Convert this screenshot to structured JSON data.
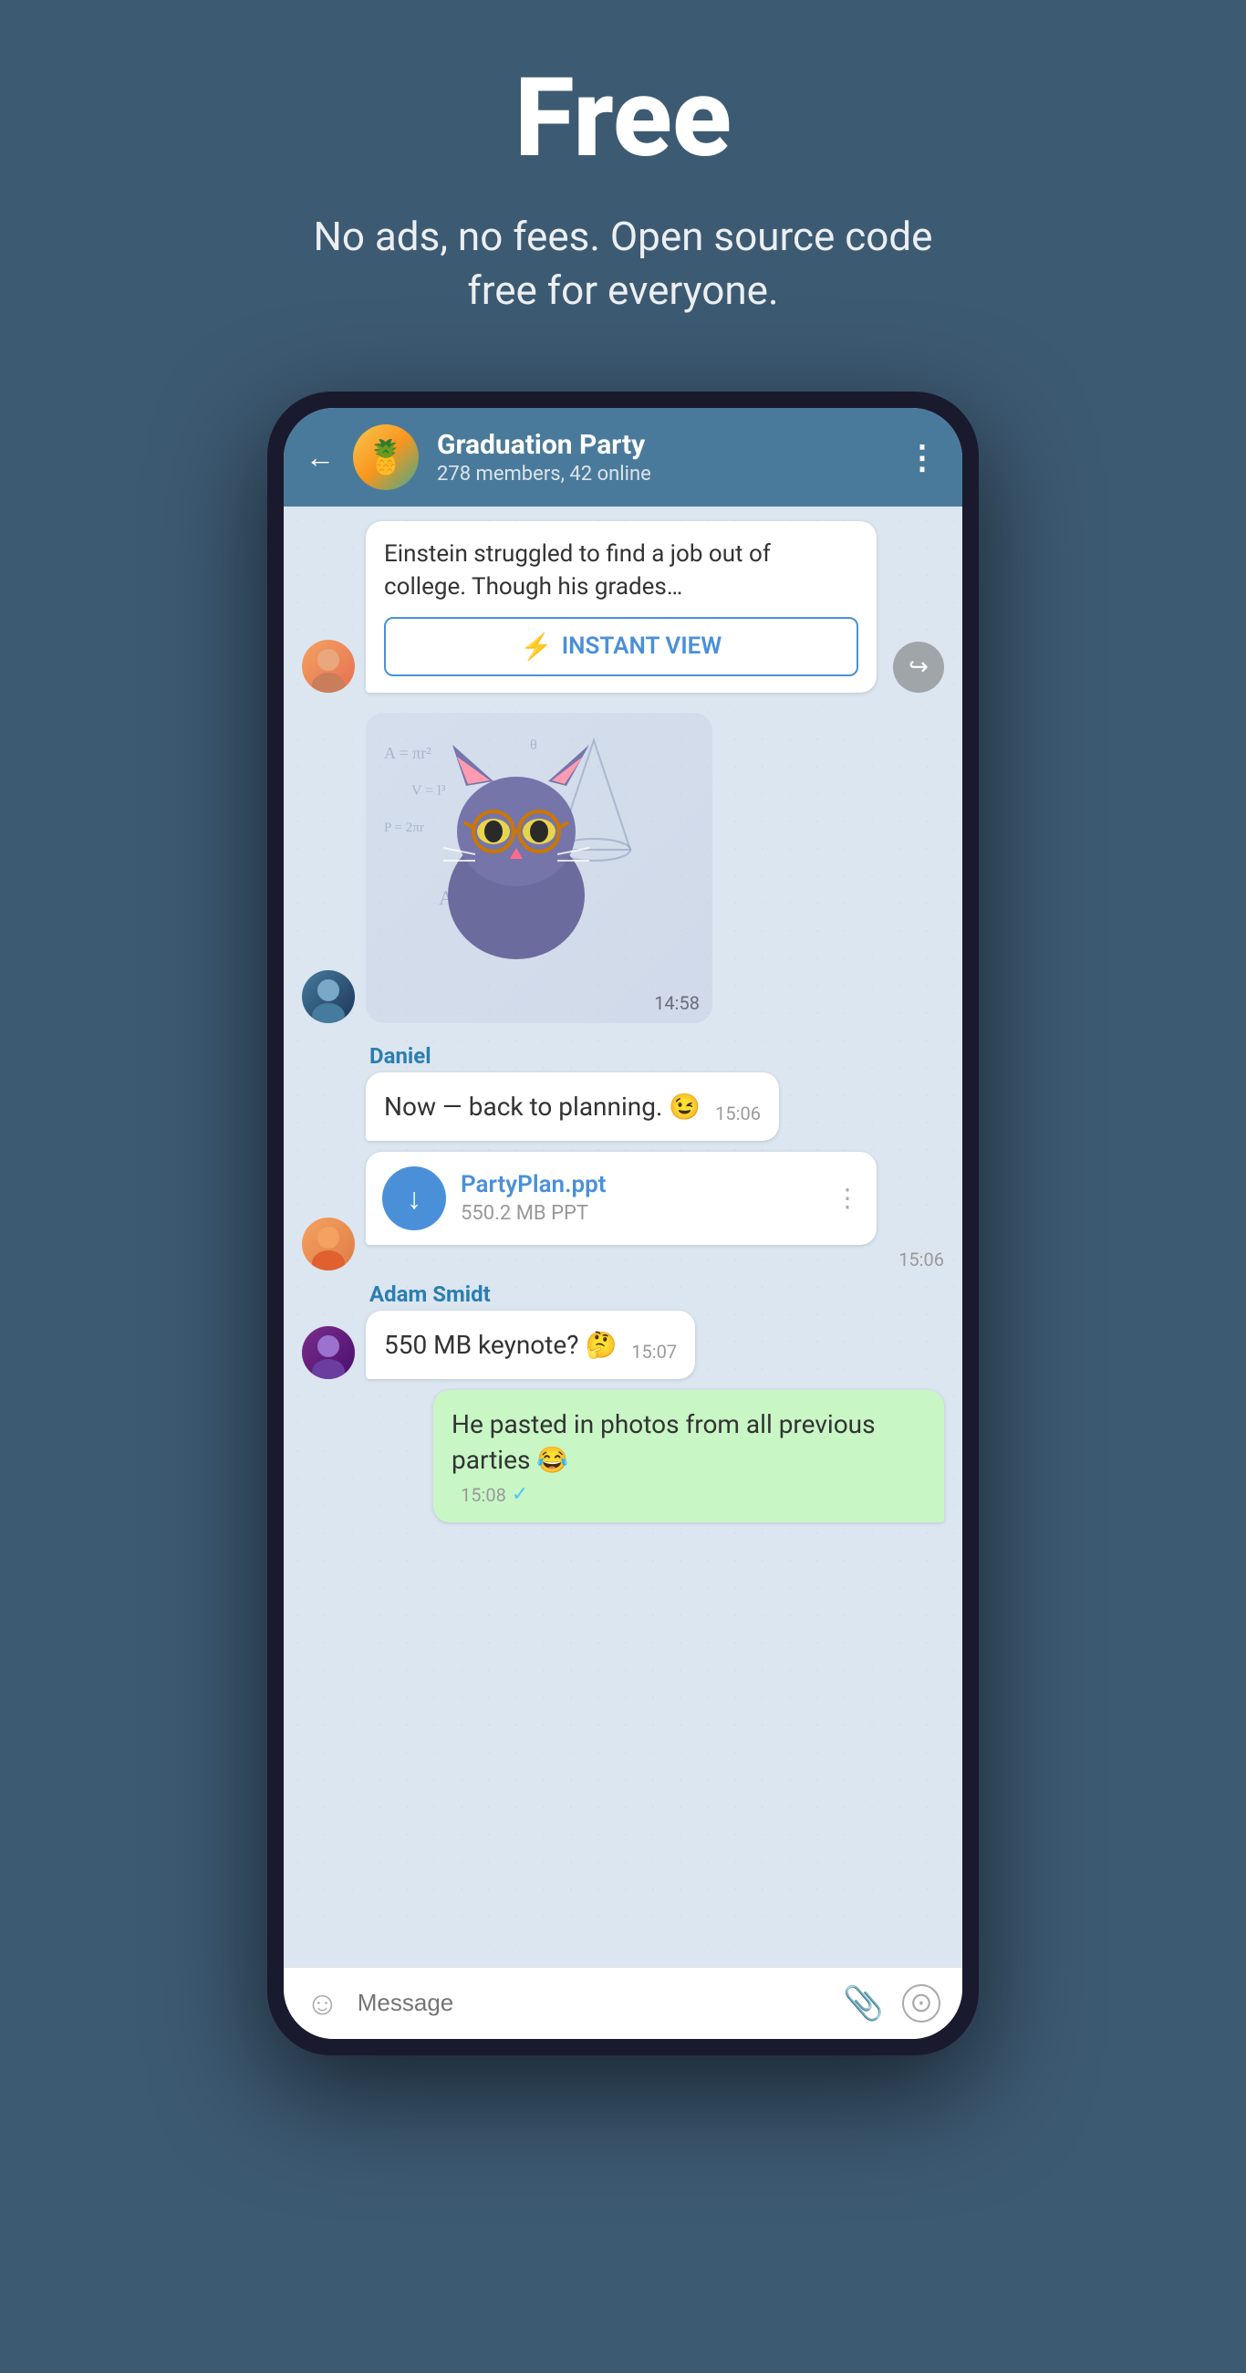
{
  "hero": {
    "title": "Free",
    "subtitle": "No ads, no fees. Open source code free for everyone."
  },
  "chat": {
    "header": {
      "back_label": "←",
      "group_emoji": "🍍",
      "group_name": "Graduation Party",
      "group_meta": "278 members, 42 online",
      "menu_dots": "⋮"
    },
    "messages": [
      {
        "type": "article",
        "text": "Einstein struggled to find a job out of college. Though his grades…",
        "instant_view_label": "INSTANT VIEW",
        "timestamp": ""
      },
      {
        "type": "sticker",
        "timestamp": "14:58"
      },
      {
        "type": "text",
        "sender": "Daniel",
        "text": "Now — back to planning. 😉",
        "timestamp": "15:06"
      },
      {
        "type": "file",
        "sender": "",
        "file_name": "PartyPlan.ppt",
        "file_size": "550.2 MB PPT",
        "timestamp": "15:06"
      },
      {
        "type": "text",
        "sender": "Adam Smidt",
        "text": "550 MB keynote? 🤔",
        "timestamp": "15:07"
      },
      {
        "type": "own",
        "text": "He pasted in photos from all previous parties 😂",
        "timestamp": "15:08",
        "read": true
      }
    ],
    "input_bar": {
      "placeholder": "Message",
      "emoji_icon": "☺",
      "attach_icon": "📎",
      "camera_icon": "⊙"
    }
  }
}
